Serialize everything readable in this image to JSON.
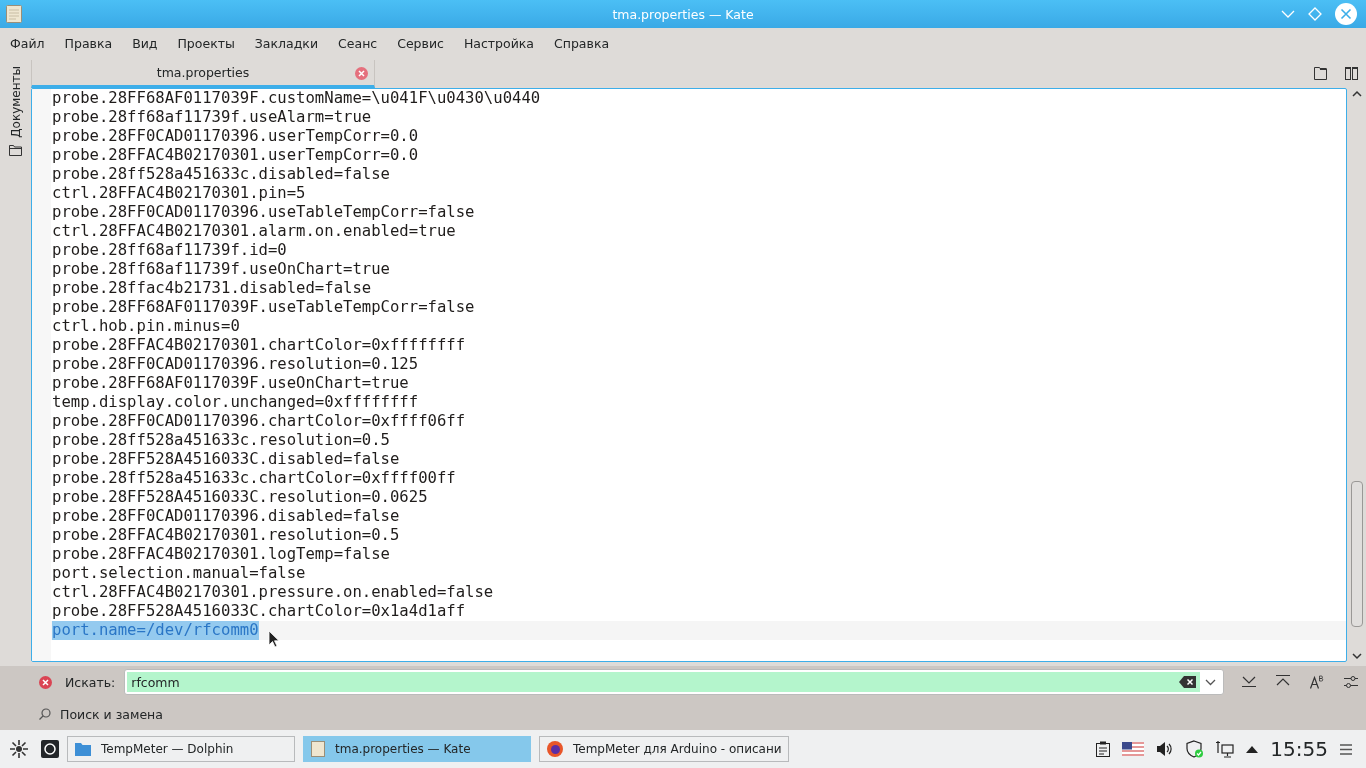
{
  "window": {
    "title": "tma.properties  — Kate"
  },
  "menu": [
    "Файл",
    "Правка",
    "Вид",
    "Проекты",
    "Закладки",
    "Сеанс",
    "Сервис",
    "Настройка",
    "Справка"
  ],
  "sidebar": {
    "label": "Документы"
  },
  "tabs": [
    {
      "label": "tma.properties",
      "selected": true
    }
  ],
  "lines": [
    {
      "text": "probe.28FF68AF0117039F.customName=\\u041F\\u0430\\u0440",
      "selected": false
    },
    {
      "text": "probe.28ff68af11739f.useAlarm=true",
      "selected": false
    },
    {
      "text": "probe.28FF0CAD01170396.userTempCorr=0.0",
      "selected": false
    },
    {
      "text": "probe.28FFAC4B02170301.userTempCorr=0.0",
      "selected": false
    },
    {
      "text": "probe.28ff528a451633c.disabled=false",
      "selected": false
    },
    {
      "text": "ctrl.28FFAC4B02170301.pin=5",
      "selected": false
    },
    {
      "text": "probe.28FF0CAD01170396.useTableTempCorr=false",
      "selected": false
    },
    {
      "text": "ctrl.28FFAC4B02170301.alarm.on.enabled=true",
      "selected": false
    },
    {
      "text": "probe.28ff68af11739f.id=0",
      "selected": false
    },
    {
      "text": "probe.28ff68af11739f.useOnChart=true",
      "selected": false
    },
    {
      "text": "probe.28ffac4b21731.disabled=false",
      "selected": false
    },
    {
      "text": "probe.28FF68AF0117039F.useTableTempCorr=false",
      "selected": false
    },
    {
      "text": "ctrl.hob.pin.minus=0",
      "selected": false
    },
    {
      "text": "probe.28FFAC4B02170301.chartColor=0xffffffff",
      "selected": false
    },
    {
      "text": "probe.28FF0CAD01170396.resolution=0.125",
      "selected": false
    },
    {
      "text": "probe.28FF68AF0117039F.useOnChart=true",
      "selected": false
    },
    {
      "text": "temp.display.color.unchanged=0xffffffff",
      "selected": false
    },
    {
      "text": "probe.28FF0CAD01170396.chartColor=0xffff06ff",
      "selected": false
    },
    {
      "text": "probe.28ff528a451633c.resolution=0.5",
      "selected": false
    },
    {
      "text": "probe.28FF528A4516033C.disabled=false",
      "selected": false
    },
    {
      "text": "probe.28ff528a451633c.chartColor=0xffff00ff",
      "selected": false
    },
    {
      "text": "probe.28FF528A4516033C.resolution=0.0625",
      "selected": false
    },
    {
      "text": "probe.28FF0CAD01170396.disabled=false",
      "selected": false
    },
    {
      "text": "probe.28FFAC4B02170301.resolution=0.5",
      "selected": false
    },
    {
      "text": "probe.28FFAC4B02170301.logTemp=false",
      "selected": false
    },
    {
      "text": "port.selection.manual=false",
      "selected": false
    },
    {
      "text": "ctrl.28FFAC4B02170301.pressure.on.enabled=false",
      "selected": false
    },
    {
      "text": "probe.28FF528A4516033C.chartColor=0x1a4d1aff",
      "selected": false
    },
    {
      "text": "port.name=/dev/rfcomm0",
      "selected": true
    }
  ],
  "search": {
    "label": "Искать:",
    "value": "rfcomm",
    "found": true
  },
  "search_replace": {
    "label": "Поиск и замена"
  },
  "taskbar": {
    "tasks": [
      {
        "label": "TempMeter — Dolphin",
        "kind": "folder",
        "selected": false
      },
      {
        "label": "tma.properties  — Kate",
        "kind": "kate",
        "selected": true
      },
      {
        "label": "TempMeter для Arduino - описани",
        "kind": "browser",
        "selected": false
      }
    ],
    "clock": "15:55"
  }
}
